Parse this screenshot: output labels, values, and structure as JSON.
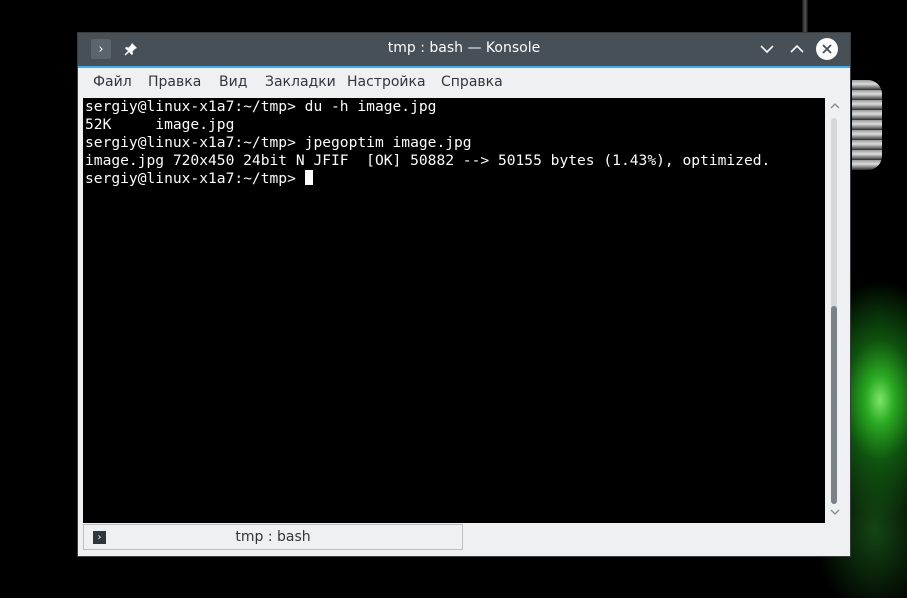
{
  "window": {
    "title": "tmp : bash — Konsole"
  },
  "menubar": {
    "items": [
      {
        "label": "Файл"
      },
      {
        "label": "Правка"
      },
      {
        "label": "Вид"
      },
      {
        "label": "Закладки"
      },
      {
        "label": "Настройка"
      },
      {
        "label": "Справка"
      }
    ]
  },
  "terminal": {
    "lines": [
      "sergiy@linux-x1a7:~/tmp> du -h image.jpg",
      "52K     image.jpg",
      "sergiy@linux-x1a7:~/tmp> jpegoptim image.jpg",
      "image.jpg 720x450 24bit N JFIF  [OK] 50882 --> 50155 bytes (1.43%), optimized.",
      "sergiy@linux-x1a7:~/tmp> "
    ]
  },
  "tabs": [
    {
      "label": "tmp : bash"
    }
  ],
  "icons": {
    "menu": "chevron-right-icon",
    "pin": "pin-icon",
    "minimize": "chevron-down-icon",
    "maximize": "chevron-up-icon",
    "close": "close-icon",
    "tab": "terminal-icon"
  },
  "colors": {
    "titlebar": "#475057",
    "accent": "#3daee9",
    "terminal_bg": "#000000",
    "terminal_fg": "#fcfcfc"
  }
}
